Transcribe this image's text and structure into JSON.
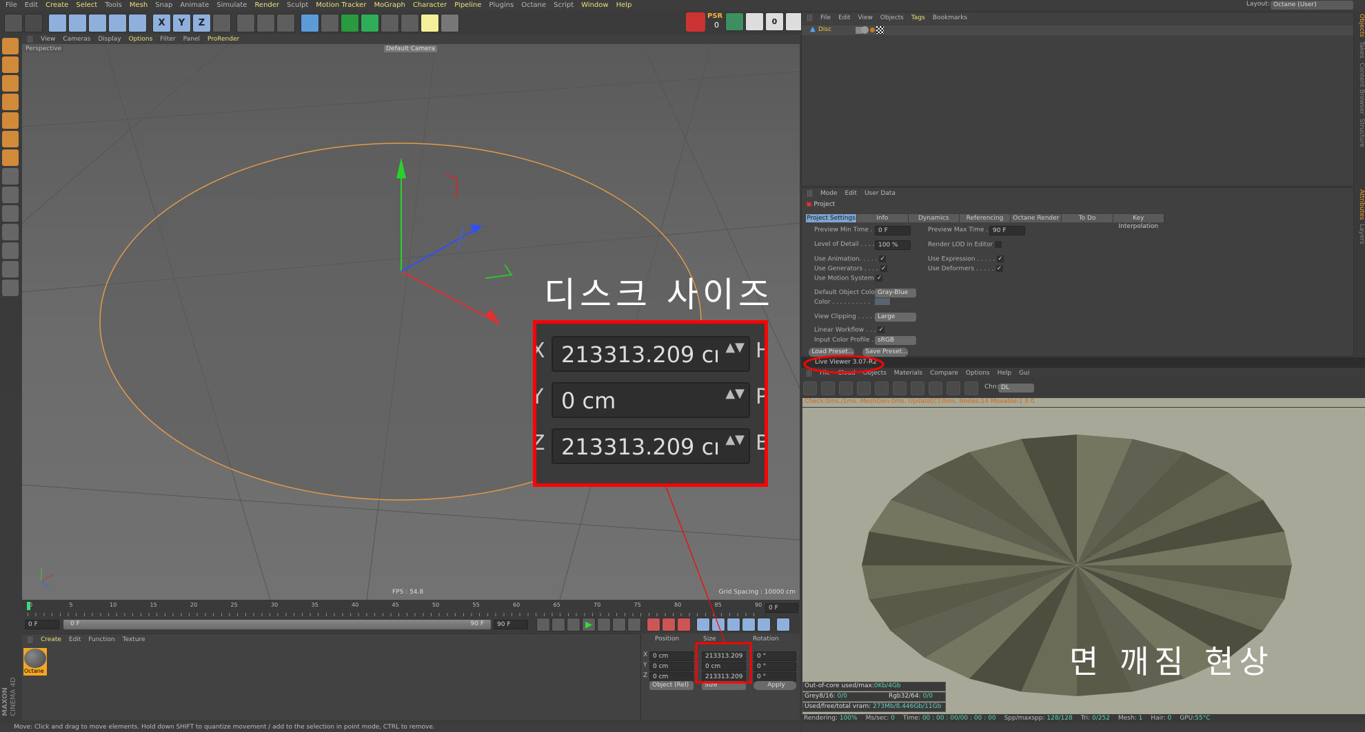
{
  "menubar": {
    "items": [
      "File",
      "Edit",
      "Create",
      "Select",
      "Tools",
      "Mesh",
      "Snap",
      "Animate",
      "Simulate",
      "Render",
      "Sculpt",
      "Motion Tracker",
      "MoGraph",
      "Character",
      "Pipeline",
      "Plugins",
      "Octane",
      "Script",
      "Window",
      "Help"
    ],
    "highlight": [
      "Create",
      "Select",
      "Mesh",
      "Render",
      "Motion Tracker",
      "MoGraph",
      "Character",
      "Pipeline",
      "Window",
      "Help"
    ],
    "layout_label": "Layout:",
    "layout_value": "Octane (User)"
  },
  "toolbar": {
    "icons": [
      "undo-icon",
      "redo-icon",
      "select-arrow-icon",
      "move-icon",
      "scale-icon",
      "rotate-icon",
      "live-select-icon",
      "x-axis-icon",
      "y-axis-icon",
      "z-axis-icon",
      "coordinate-system-icon",
      "render-view-icon",
      "render-picture-icon",
      "render-settings-icon",
      "cube-icon",
      "pen-icon",
      "subdivision-icon",
      "array-icon",
      "deformer-icon",
      "floor-icon",
      "camera-icon",
      "light-icon"
    ],
    "xyz": [
      "X",
      "Y",
      "Z"
    ],
    "psr_label": "PSR",
    "psr_value": "0",
    "right_value": "0"
  },
  "viewport": {
    "menu": [
      "View",
      "Cameras",
      "Display",
      "Options",
      "Filter",
      "Panel",
      "ProRender"
    ],
    "menu_highlight": [
      "Options",
      "ProRender"
    ],
    "label": "Perspective",
    "camera": "Default Camera",
    "fps": "FPS : 54.8",
    "grid_spacing": "Grid Spacing : 10000 cm",
    "object_color": "#e39a4a"
  },
  "timeline": {
    "ticks": [
      "0",
      "5",
      "10",
      "15",
      "20",
      "25",
      "30",
      "35",
      "40",
      "45",
      "50",
      "55",
      "60",
      "65",
      "70",
      "75",
      "80",
      "85",
      "90"
    ],
    "current_frame": "0 F",
    "start": "0 F",
    "range_start": "0 F",
    "range_end": "90 F",
    "end": "90 F"
  },
  "materials": {
    "menu": [
      "Create",
      "Edit",
      "Function",
      "Texture"
    ],
    "items": [
      {
        "name": "Octane"
      }
    ],
    "brand_top": "MAXON",
    "brand_bottom": "CINEMA 4D"
  },
  "coordinates": {
    "headers": [
      "Position",
      "Size",
      "Rotation"
    ],
    "rows": [
      {
        "axis": "X",
        "pos": "0 cm",
        "size": "213313.209 cı",
        "rot_axis": "H",
        "rot": "0 °"
      },
      {
        "axis": "Y",
        "pos": "0 cm",
        "size": "0 cm",
        "rot_axis": "P",
        "rot": "0 °"
      },
      {
        "axis": "Z",
        "pos": "0 cm",
        "size": "213313.209 cı",
        "rot_axis": "B",
        "rot": "0 °"
      }
    ],
    "mode": "Object (Rel)",
    "size_mode": "Size",
    "apply": "Apply"
  },
  "statusbar": "Move: Click and drag to move elements. Hold down SHIFT to quantize movement / add to the selection in point mode, CTRL to remove.",
  "objects": {
    "menu": [
      "File",
      "Edit",
      "View",
      "Objects",
      "Tags",
      "Bookmarks"
    ],
    "items": [
      {
        "name": "Disc"
      }
    ],
    "side_tabs": [
      "Objects",
      "Takes",
      "Content Browser",
      "Structure"
    ]
  },
  "attributes": {
    "menu": [
      "Mode",
      "Edit",
      "User Data"
    ],
    "title": "Project",
    "tabs": [
      "Project Settings",
      "Info",
      "Dynamics",
      "Referencing",
      "Octane Render",
      "To Do",
      "Key Interpolation"
    ],
    "preview_min_label": "Preview Min Time . .",
    "preview_min": "0 F",
    "preview_max_label": "Preview Max Time . . .",
    "preview_max": "90 F",
    "lod_label": "Level of Detail . . . . .",
    "lod": "100 %",
    "render_lod_label": "Render LOD in Editor",
    "use_animation": "Use Animation. . . . .",
    "use_generators": "Use Generators . . . .",
    "use_motion": "Use Motion System",
    "use_expression": "Use Expression . . . . .",
    "use_deformers": "Use Deformers . . . . .",
    "default_color_label": "Default Object Color",
    "default_color": "Gray-Blue",
    "color_label": "Color . . . . . . . . . .",
    "view_clipping_label": "View Clipping . . . . .",
    "view_clipping": "Large",
    "linear_label": "Linear Workflow . . .",
    "input_profile_label": "Input Color Profile .",
    "input_profile": "sRGB",
    "load_preset": "Load Preset...",
    "save_preset": "Save Preset...",
    "side_tabs": [
      "Attributes",
      "Layers"
    ]
  },
  "live_viewer": {
    "title": "Live Viewer 3.07-R2",
    "menu": [
      "File",
      "Cloud",
      "Objects",
      "Materials",
      "Compare",
      "Options",
      "Help",
      "Gui"
    ],
    "chn_label": "Chn:",
    "chn": "DL",
    "status": "Check:0ms./1ms. MeshGen:0ms. Update[C]:0ms. Nodes:14 Movable:1  0 0",
    "stats": [
      {
        "label": "Out-of-core used/max:",
        "value": "0Kb/4Gb"
      },
      {
        "label": "Grey8/16: ",
        "value": "0/0",
        "label2": "Rgb32/64: ",
        "value2": "0/0"
      },
      {
        "label": "Used/free/total vram: ",
        "value": "273Mb/8.446Gb/11Gb"
      }
    ],
    "bottom": [
      {
        "label": "Rendering: ",
        "value": "100%"
      },
      {
        "label": "Ms/sec: ",
        "value": "0"
      },
      {
        "label": "Time: ",
        "value": "00 : 00 : 00/00 : 00 : 00"
      },
      {
        "label": "Spp/maxspp: ",
        "value": "128/128"
      },
      {
        "label": "Tri: ",
        "value": "0/252"
      },
      {
        "label": "Mesh: ",
        "value": "1"
      },
      {
        "label": "Hair: ",
        "value": "0"
      },
      {
        "label": "GPU:",
        "value": "55°C"
      }
    ]
  },
  "annotations": {
    "disc_size": "디스크 사이즈",
    "face_break": "면 깨짐 현상",
    "zoom_rows": [
      {
        "axis": "X",
        "value": "213313.209 cı",
        "right": "H"
      },
      {
        "axis": "Y",
        "value": "0 cm",
        "right": "P"
      },
      {
        "axis": "Z",
        "value": "213313.209 cı",
        "right": "B"
      }
    ],
    "color": "#ff0000"
  }
}
